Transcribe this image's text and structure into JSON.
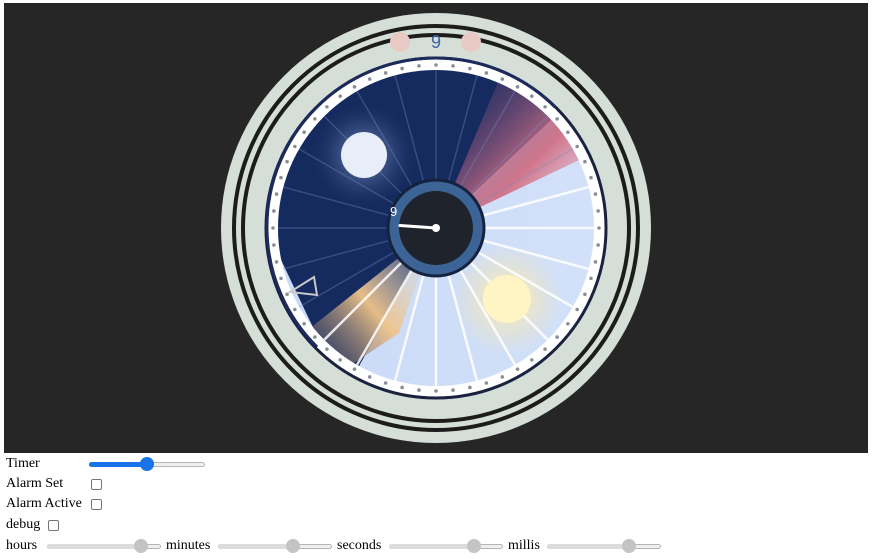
{
  "clock": {
    "top_number": "9",
    "center_partial_digit": "9",
    "hour_hand_angle_deg": 103,
    "colors": {
      "background": "#262626",
      "bezel": "#d5dfd8",
      "night": "#152a5e",
      "day": "#c9daf7",
      "sunset": "#d06f86",
      "sunrise": "#e8b87a",
      "sun": "#fff5c4",
      "moon": "#e7eef8",
      "hub": "#3c6496",
      "hub_inner": "#1f232b"
    }
  },
  "controls": {
    "timer": {
      "label": "Timer",
      "value_fraction": 0.5
    },
    "alarm_set": {
      "label": "Alarm Set",
      "checked": false
    },
    "alarm_active": {
      "label": "Alarm Active",
      "checked": false
    },
    "debug": {
      "label": "debug",
      "checked": false
    }
  },
  "time_sliders": [
    {
      "label": "hours",
      "value_fraction": 0.87
    },
    {
      "label": "minutes",
      "value_fraction": 0.68
    },
    {
      "label": "seconds",
      "value_fraction": 0.78
    },
    {
      "label": "millis",
      "value_fraction": 0.75
    }
  ]
}
